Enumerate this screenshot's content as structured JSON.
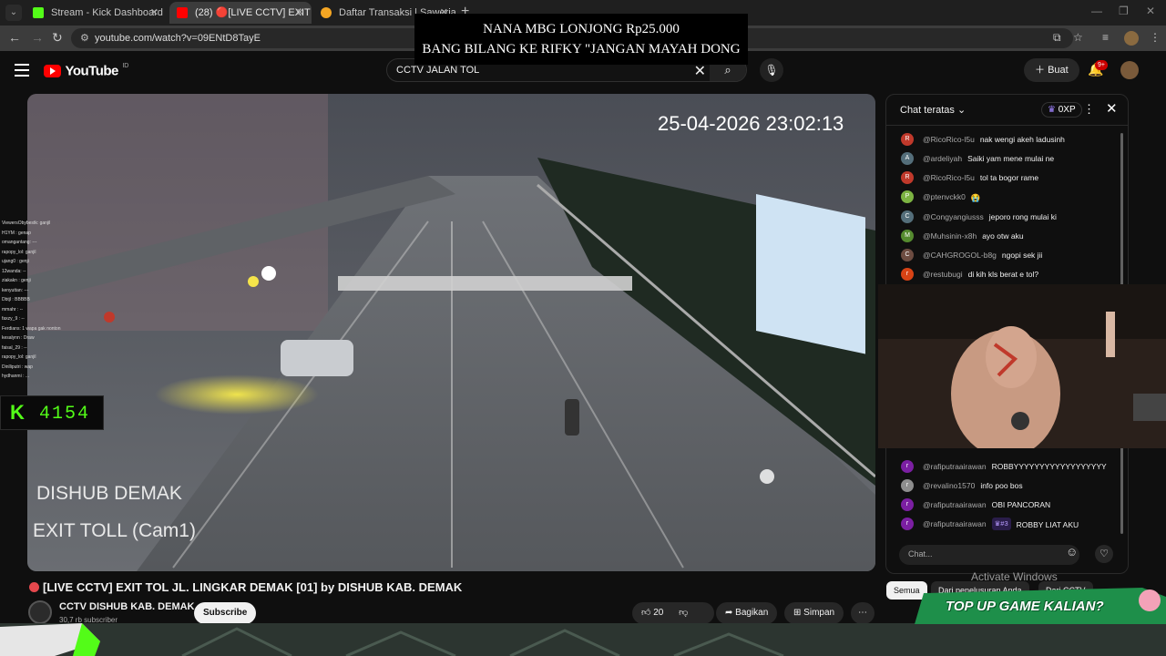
{
  "browser": {
    "tabs": [
      {
        "title": "Stream - Kick Dashboard",
        "color": "#53fc18"
      },
      {
        "title": "(28) 🔴[LIVE CCTV] EXIT TO",
        "color": "#ff0000"
      },
      {
        "title": "Daftar Transaksi | Saweria",
        "color": "#f5a623"
      }
    ],
    "url": "youtube.com/watch?v=09ENtD8TayE"
  },
  "banner": {
    "line1": "NANA MBG LONJONG Rp25.000",
    "line2": "BANG BILANG KE RIFKY \"JANGAN MAYAH DONG"
  },
  "header": {
    "logo": "YouTube",
    "country": "ID",
    "search_query": "CCTV JALAN TOL",
    "create_label": "Buat",
    "notif_count": "9+"
  },
  "video": {
    "timestamp": "25-04-2026 23:02:13",
    "label1": "DISHUB DEMAK",
    "label2": "EXIT TOLL (Cam1)",
    "kick_viewers": "4154",
    "side_chat": [
      "ViewersObybestk: ganjil",
      "H1YM : genap",
      "omangantang: ---",
      "rapopy_lol: ganjil",
      "ujang0 : genji",
      "12wanda: --",
      "ziakakn : genji",
      "kenyuttan: ---",
      "Dbtjl : BBBBB",
      "mmahr : --",
      "faxzy_9 : --",
      "Ferdians: 1 wapa gak nonton",
      "kesalynn : Draw",
      "faisal_29 : --",
      "rapopy_lol: ganjil",
      "Dinlliputri : wap",
      "hydhanmi : ..."
    ]
  },
  "chat": {
    "title": "Chat teratas",
    "xp": "0XP",
    "input_placeholder": "Chat...",
    "messages_top": [
      {
        "initial": "R",
        "author": "@RicoRico-l5u",
        "text": "nak wengi akeh ladusinh",
        "color": "#c0392b"
      },
      {
        "initial": "A",
        "author": "@ardeliyah",
        "text": "Saiki yam mene mulai ne",
        "color": "#546e7a"
      },
      {
        "initial": "R",
        "author": "@RicoRico-l5u",
        "text": "tol ta bogor rame",
        "color": "#c0392b"
      },
      {
        "initial": "P",
        "author": "@ptenvckk0",
        "text": "😭",
        "color": "#7cb342"
      },
      {
        "initial": "C",
        "author": "@Congyangiusss",
        "text": "jeporo rong mulai ki",
        "color": "#546e7a"
      },
      {
        "initial": "M",
        "author": "@Muhsinin-x8h",
        "text": "ayo otw aku",
        "color": "#558b2f"
      },
      {
        "initial": "C",
        "author": "@CAHGROGOL-b8g",
        "text": "ngopi sek jii",
        "color": "#6d4c41"
      },
      {
        "initial": "r",
        "author": "@restubugi",
        "text": "di kih kls berat e tol?",
        "color": "#d84315"
      }
    ],
    "messages_bottom": [
      {
        "initial": "r",
        "author": "@rafiputraairawan",
        "text": "ROBBYYYYYYYYYYYYYYYYYY",
        "color": "#7b1fa2",
        "badge": ""
      },
      {
        "initial": "r",
        "author": "@revalino1570",
        "text": "info poo bos",
        "color": "#8e8e8e",
        "badge": ""
      },
      {
        "initial": "r",
        "author": "@rafiputraairawan",
        "text": "OBI PANCORAN",
        "color": "#7b1fa2",
        "badge": ""
      },
      {
        "initial": "r",
        "author": "@rafiputraairawan",
        "text": "ROBBY LIAT AKU",
        "color": "#7b1fa2",
        "badge": "#3"
      }
    ]
  },
  "below": {
    "title": "[LIVE CCTV] EXIT TOL JL. LINGKAR DEMAK [01] by DISHUB KAB. DEMAK",
    "channel": "CCTV DISHUB KAB. DEMAK",
    "subscribers": "30,7 rb subscriber",
    "subscribe_label": "Subscribe",
    "likes": "20",
    "share_label": "Bagikan",
    "save_label": "Simpan",
    "chips": [
      "Semua",
      "Dari penelusuran Anda",
      "Dari CCTV"
    ],
    "activate": "Activate Windows",
    "promo": "TOP UP GAME KALIAN?"
  }
}
